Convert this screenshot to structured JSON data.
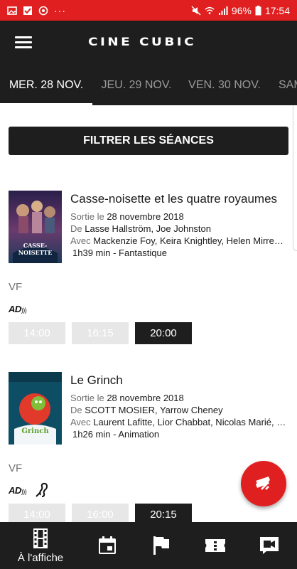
{
  "status_bar": {
    "battery": "96%",
    "time": "17:54",
    "left_icons": [
      "image-icon",
      "check-icon",
      "sync-icon",
      "more-dots-icon"
    ],
    "right_icons": [
      "mute-icon",
      "wifi-icon",
      "signal-icon",
      "battery-icon"
    ],
    "color": "#e02020"
  },
  "app": {
    "logo": "CINE CUBIC",
    "menu_icon": "hamburger-menu-icon"
  },
  "date_tabs": [
    {
      "label": "MER. 28 NOV.",
      "active": true
    },
    {
      "label": "JEU. 29 NOV.",
      "active": false
    },
    {
      "label": "VEN. 30 NOV.",
      "active": false
    },
    {
      "label": "SAM",
      "active": false
    }
  ],
  "filter_button": "FILTRER LES SÉANCES",
  "movies": [
    {
      "title": "Casse-noisette et les quatre royaumes",
      "release_label": "Sortie le",
      "release_date": "28 novembre 2018",
      "director_label": "De",
      "directors": "Lasse Hallström, Joe Johnston",
      "cast_label": "Avec",
      "cast": "Mackenzie Foy, Keira Knightley, Helen Mirren, Morgan Freeman",
      "duration_genre": "1h39 min - Fantastique",
      "poster_text": "CASSE-NOISETTE",
      "version": "VF",
      "accessibility": [
        "audio-description-icon"
      ],
      "ad_label": "AD",
      "showtimes": [
        {
          "time": "14:00",
          "state": "disabled"
        },
        {
          "time": "16:15",
          "state": "disabled"
        },
        {
          "time": "20:00",
          "state": "available"
        }
      ]
    },
    {
      "title": "Le Grinch",
      "release_label": "Sortie le",
      "release_date": "28 novembre 2018",
      "director_label": "De",
      "directors": "SCOTT MOSIER, Yarrow Cheney",
      "cast_label": "Avec",
      "cast": "Laurent Lafitte, Lior Chabbat, Nicolas Marié, Rémi Bichet",
      "duration_genre": "1h26 min - Animation",
      "poster_text": "Grinch",
      "version": "VF",
      "accessibility": [
        "audio-description-icon",
        "hearing-assistance-icon"
      ],
      "ad_label": "AD",
      "showtimes": [
        {
          "time": "14:00",
          "state": "disabled"
        },
        {
          "time": "16:00",
          "state": "disabled"
        },
        {
          "time": "20:15",
          "state": "available"
        }
      ]
    }
  ],
  "fab_icon": "ticket-booking-icon",
  "bottom_nav": [
    {
      "label": "À l'affiche",
      "icon": "film-strip-icon",
      "active": true
    },
    {
      "label": "",
      "icon": "calendar-icon",
      "active": false
    },
    {
      "label": "",
      "icon": "flag-icon",
      "active": false
    },
    {
      "label": "",
      "icon": "ticket-icon",
      "active": false
    },
    {
      "label": "",
      "icon": "video-camera-icon",
      "active": false
    }
  ]
}
